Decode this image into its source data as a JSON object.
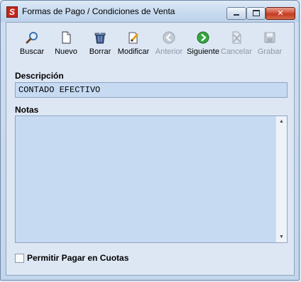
{
  "window": {
    "title": "Formas de Pago / Condiciones de Venta",
    "icon": "S",
    "controls": {
      "minimize": "minimize-icon",
      "maximize": "maximize-icon",
      "close": "close-icon"
    }
  },
  "toolbar": {
    "buttons": [
      {
        "id": "buscar",
        "label": "Buscar",
        "icon": "magnifier-icon",
        "enabled": true
      },
      {
        "id": "nuevo",
        "label": "Nuevo",
        "icon": "new-document-icon",
        "enabled": true
      },
      {
        "id": "borrar",
        "label": "Borrar",
        "icon": "trash-icon",
        "enabled": true
      },
      {
        "id": "modificar",
        "label": "Modificar",
        "icon": "edit-document-icon",
        "enabled": true
      },
      {
        "id": "anterior",
        "label": "Anterior",
        "icon": "arrow-left-icon",
        "enabled": false
      },
      {
        "id": "siguiente",
        "label": "Siguiente",
        "icon": "arrow-right-icon",
        "enabled": true
      },
      {
        "id": "cancelar",
        "label": "Cancelar",
        "icon": "cancel-icon",
        "enabled": false
      },
      {
        "id": "grabar",
        "label": "Grabar",
        "icon": "floppy-disk-icon",
        "enabled": false
      }
    ]
  },
  "form": {
    "descripcion_label": "Descripción",
    "descripcion_value": "CONTADO EFECTIVO",
    "notas_label": "Notas",
    "notas_value": "",
    "cuotas_label": "Permitir Pagar en Cuotas",
    "cuotas_checked": false
  },
  "colors": {
    "field_background": "#c6daf2",
    "window_background": "#dde7f4",
    "disabled_text": "#8d97a4",
    "arrow_enabled": "#2a9a3a",
    "arrow_disabled": "#a9b2bd"
  }
}
